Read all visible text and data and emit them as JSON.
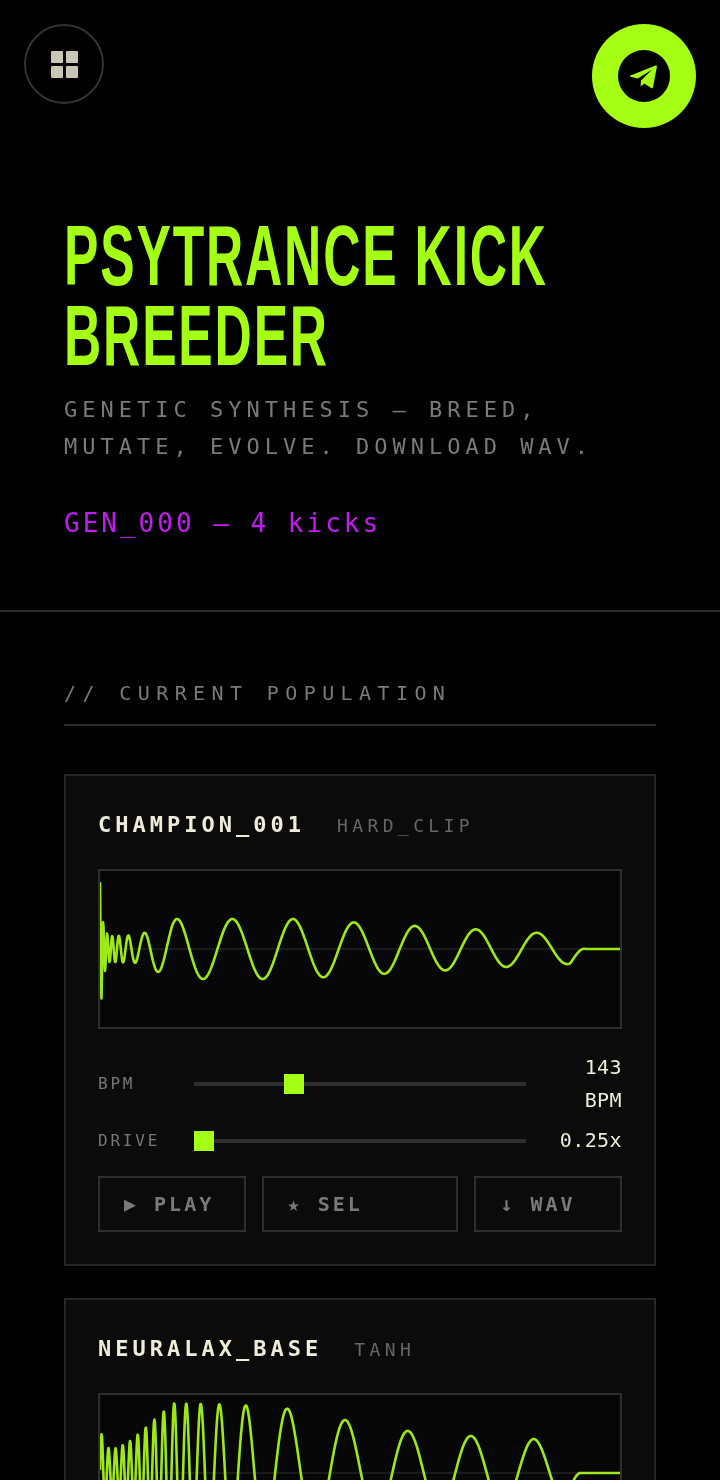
{
  "title": "PSYTRANCE KICK BREEDER",
  "subtitle": "GENETIC SYNTHESIS — BREED, MUTATE, EVOLVE. DOWNLOAD WAV.",
  "generation": "GEN_000 — 4 kicks",
  "section": {
    "heading": "// CURRENT POPULATION"
  },
  "population": [
    {
      "name": "CHAMPION_001",
      "tag": "HARD_CLIP",
      "sliders": [
        {
          "label": "BPM",
          "level": 0.29,
          "reading": "143 BPM"
        },
        {
          "label": "DRIVE",
          "level": 0,
          "reading": "0.25x"
        }
      ],
      "buttons": [
        "▶ PLAY",
        "★ SEL",
        "↓ WAV"
      ]
    },
    {
      "name": "NEURALAX_BASE",
      "tag": "TANH"
    }
  ]
}
